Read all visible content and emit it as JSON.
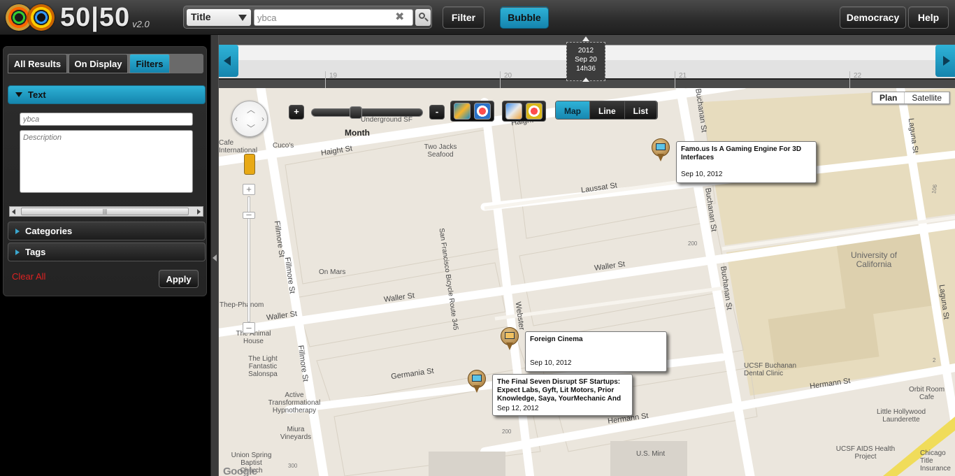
{
  "app": {
    "logo_text": "50|50",
    "version": "v2.0"
  },
  "search": {
    "field": "Title",
    "value": "ybca",
    "clear_symbol": "✖"
  },
  "topbar": {
    "filter_label": "Filter",
    "bubble_label": "Bubble",
    "democracy_label": "Democracy",
    "help_label": "Help"
  },
  "panel": {
    "tabs": [
      "All Results",
      "On Display",
      "Filters"
    ],
    "active_tab": "Filters",
    "text_section": "Text",
    "name_placeholder": "ybca",
    "description_placeholder": "Description",
    "categories_label": "Categories",
    "tags_label": "Tags",
    "clear_all_label": "Clear All",
    "apply_label": "Apply"
  },
  "timeline": {
    "ticks": [
      "19",
      "20",
      "21",
      "22"
    ],
    "marker": {
      "year": "2012",
      "date": "Sep 20",
      "time": "14h36"
    }
  },
  "map_controls": {
    "zoom_in": "+",
    "zoom_out": "-",
    "slider_plus": "+",
    "slider_minus": "-",
    "resolution": "Month",
    "views": [
      "Map",
      "Line",
      "List"
    ],
    "active_view": "Map",
    "map_types": [
      "Plan",
      "Satellite"
    ],
    "active_map_type": "Plan",
    "app_icons": [
      "app-3-icon",
      "target-icon",
      "app-grid-icon",
      "target-icon"
    ]
  },
  "map_labels": {
    "streets": [
      "Haight St",
      "Haight St",
      "Laussat St",
      "Waller St",
      "Waller St",
      "Waller St",
      "Germania St",
      "Hermann St",
      "Hermann St",
      "Fillmore St",
      "Fillmore St",
      "Fillmore St",
      "San Francisco Bicycle Route 345",
      "Webster",
      "Buchanan St",
      "Buchanan St",
      "Buchanan St",
      "Laguna St",
      "Laguna St"
    ],
    "pois": [
      "Underground SF",
      "Cafe International",
      "Cuco's",
      "Two Jacks Seafood",
      "On Mars",
      "Thep-Phanom",
      "The Animal House",
      "The Light Fantastic Salonspa",
      "Active Transformational Hypnotherapy",
      "Miura Vineyards",
      "Union Spring Baptist Church",
      "University of California",
      "UCSF Buchanan Dental Clinic",
      "Orbit Room Cafe",
      "Little Hollywood Launderette",
      "UCSF AIDS Health Project",
      "Chicago Title Insurance",
      "U.S. Mint"
    ],
    "numbers": [
      "200",
      "200",
      "300",
      "106",
      "2"
    ],
    "attribution": "Google"
  },
  "events": [
    {
      "title": "Famo.us Is A Gaming Engine For 3D Interfaces",
      "date": "Sep 10, 2012"
    },
    {
      "title": "Foreign Cinema",
      "date": "Sep 10, 2012"
    },
    {
      "title": "The Final Seven Disrupt SF Startups: Expect Labs, Gyft, Lit Motors, Prior Knowledge, Saya, YourMechanic And",
      "date": "Sep 12, 2012"
    }
  ],
  "colors": {
    "accent": "#1e9cc8",
    "clear_all": "#dd2222",
    "map_bg": "#ebe6dd",
    "campus": "#e7dcbe"
  }
}
